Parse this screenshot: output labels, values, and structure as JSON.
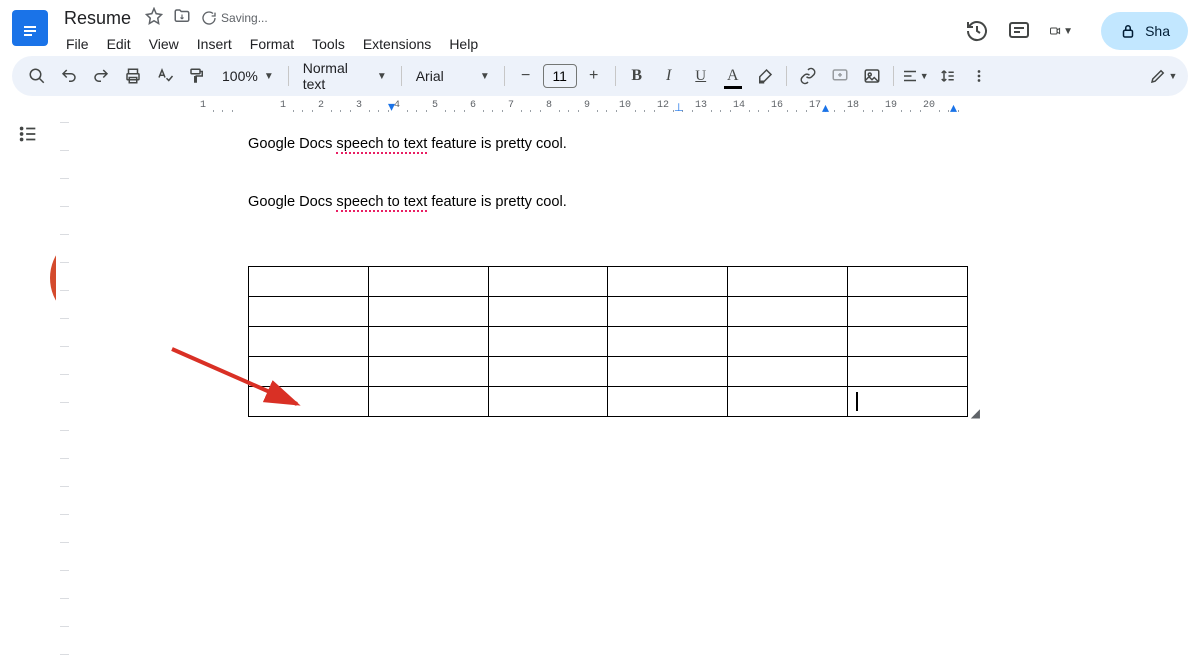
{
  "header": {
    "doc_title": "Resume",
    "saving_text": "Saving...",
    "menus": [
      "File",
      "Edit",
      "View",
      "Insert",
      "Format",
      "Tools",
      "Extensions",
      "Help"
    ],
    "share_label": "Sha"
  },
  "toolbar": {
    "zoom": "100%",
    "style": "Normal text",
    "font": "Arial",
    "font_size": "11"
  },
  "ruler": {
    "numbers": [
      1,
      1,
      2,
      3,
      4,
      5,
      6,
      7,
      8,
      9,
      10,
      12,
      13,
      14,
      16,
      17,
      18,
      19,
      20
    ],
    "eleven_hidden": ""
  },
  "document": {
    "line1": {
      "pre": "Google Docs ",
      "sqg": "speech to text",
      "post": " feature is pretty cool."
    },
    "line2": {
      "pre": "Google Docs ",
      "sqg": "speech to text",
      "post": " feature is pretty cool."
    },
    "table": {
      "rows": 5,
      "cols": 6
    }
  },
  "icons": {
    "star": "star-icon",
    "move": "move-folder-icon",
    "cloud": "saving-icon"
  }
}
